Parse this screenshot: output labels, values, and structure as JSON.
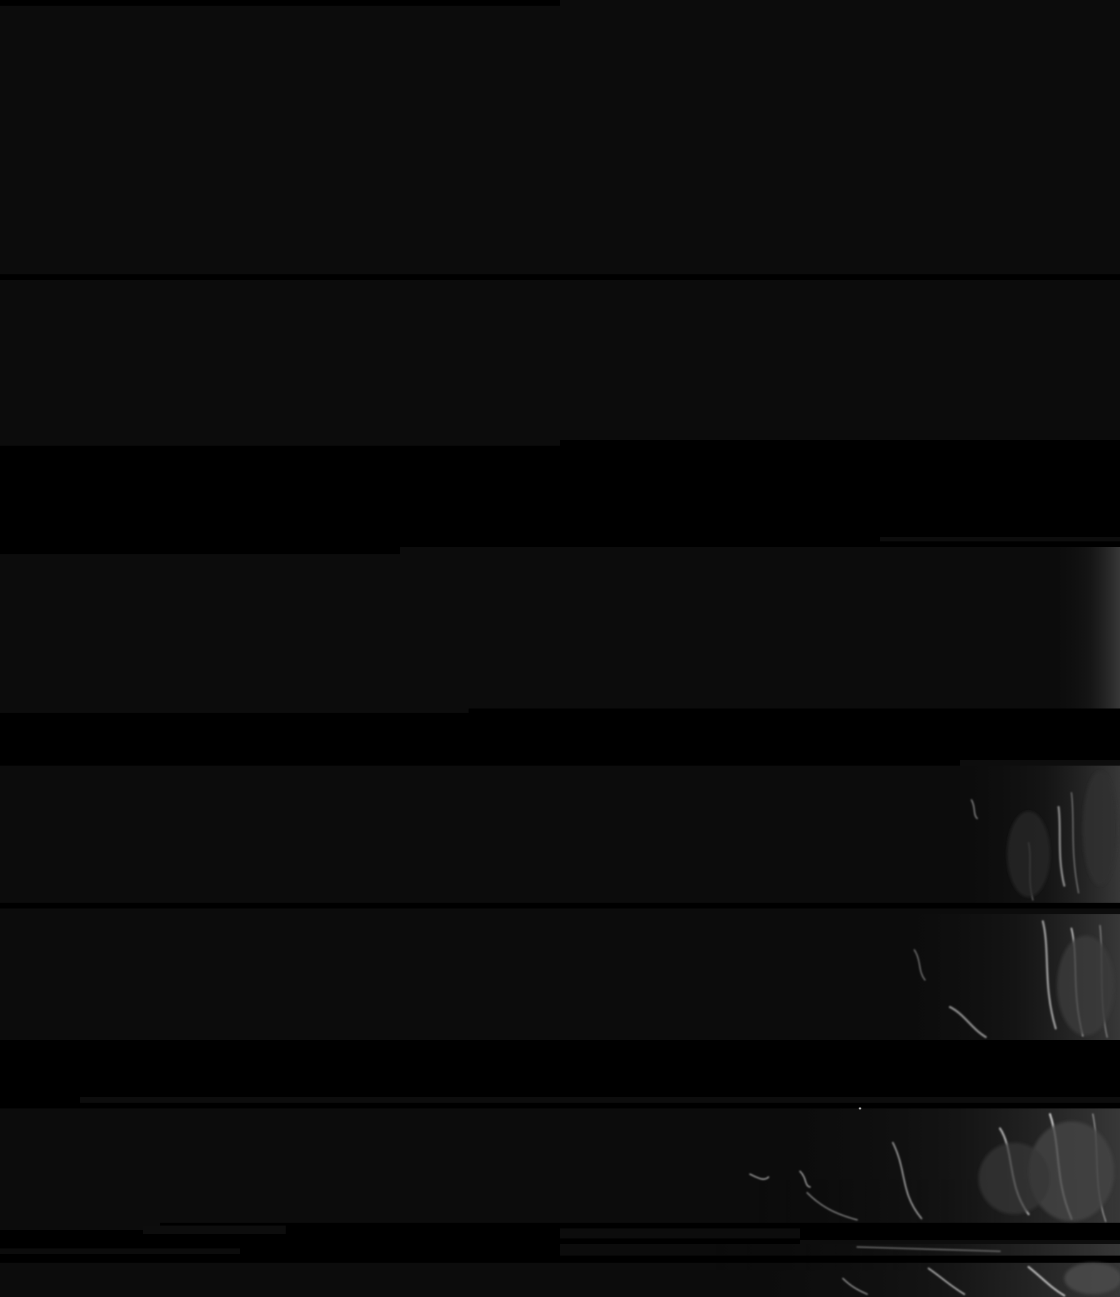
{
  "image": {
    "kind": "satellite-scan",
    "colors": {
      "background": "#000000",
      "space": "#0c0c0c",
      "cloud_light": "#cfcfcf",
      "cloud_mid": "#7a7a7a",
      "cloud_dark": "#2a2a2a"
    }
  }
}
